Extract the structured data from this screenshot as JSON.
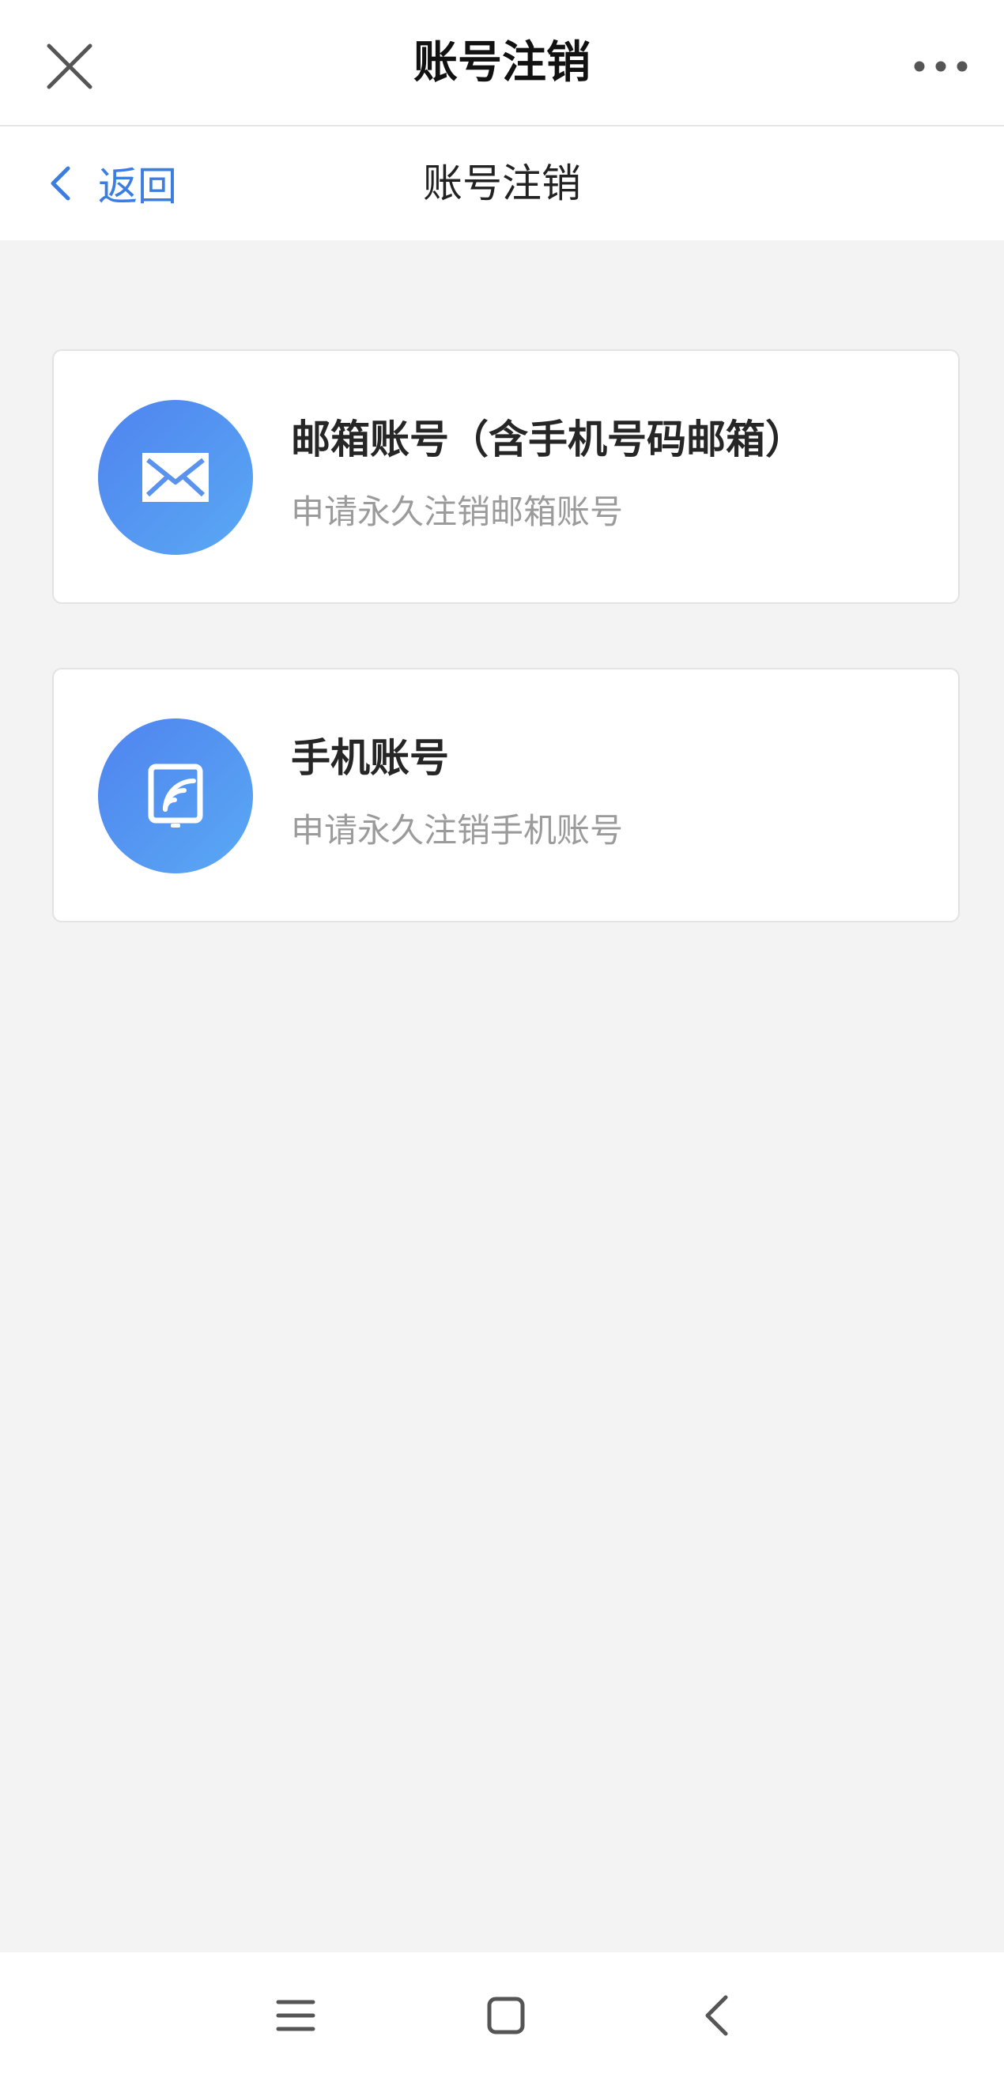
{
  "topbar": {
    "title": "账号注销",
    "close_icon": "close-icon",
    "more_icon": "more-dots-icon"
  },
  "subnav": {
    "back_label": "返回",
    "title": "账号注销",
    "back_icon": "chevron-left-icon"
  },
  "options": [
    {
      "title": "邮箱账号（含手机号码邮箱）",
      "description": "申请永久注销邮箱账号",
      "icon": "envelope-icon"
    },
    {
      "title": "手机账号",
      "description": "申请永久注销手机账号",
      "icon": "phone-account-icon"
    }
  ],
  "system_nav": {
    "menu_icon": "menu-icon",
    "home_icon": "home-icon",
    "back_icon": "back-icon"
  },
  "colors": {
    "accent": "#3b7de0",
    "icon_gradient_start": "#4f83ef",
    "icon_gradient_end": "#5aa9f4",
    "background": "#f3f3f3"
  }
}
